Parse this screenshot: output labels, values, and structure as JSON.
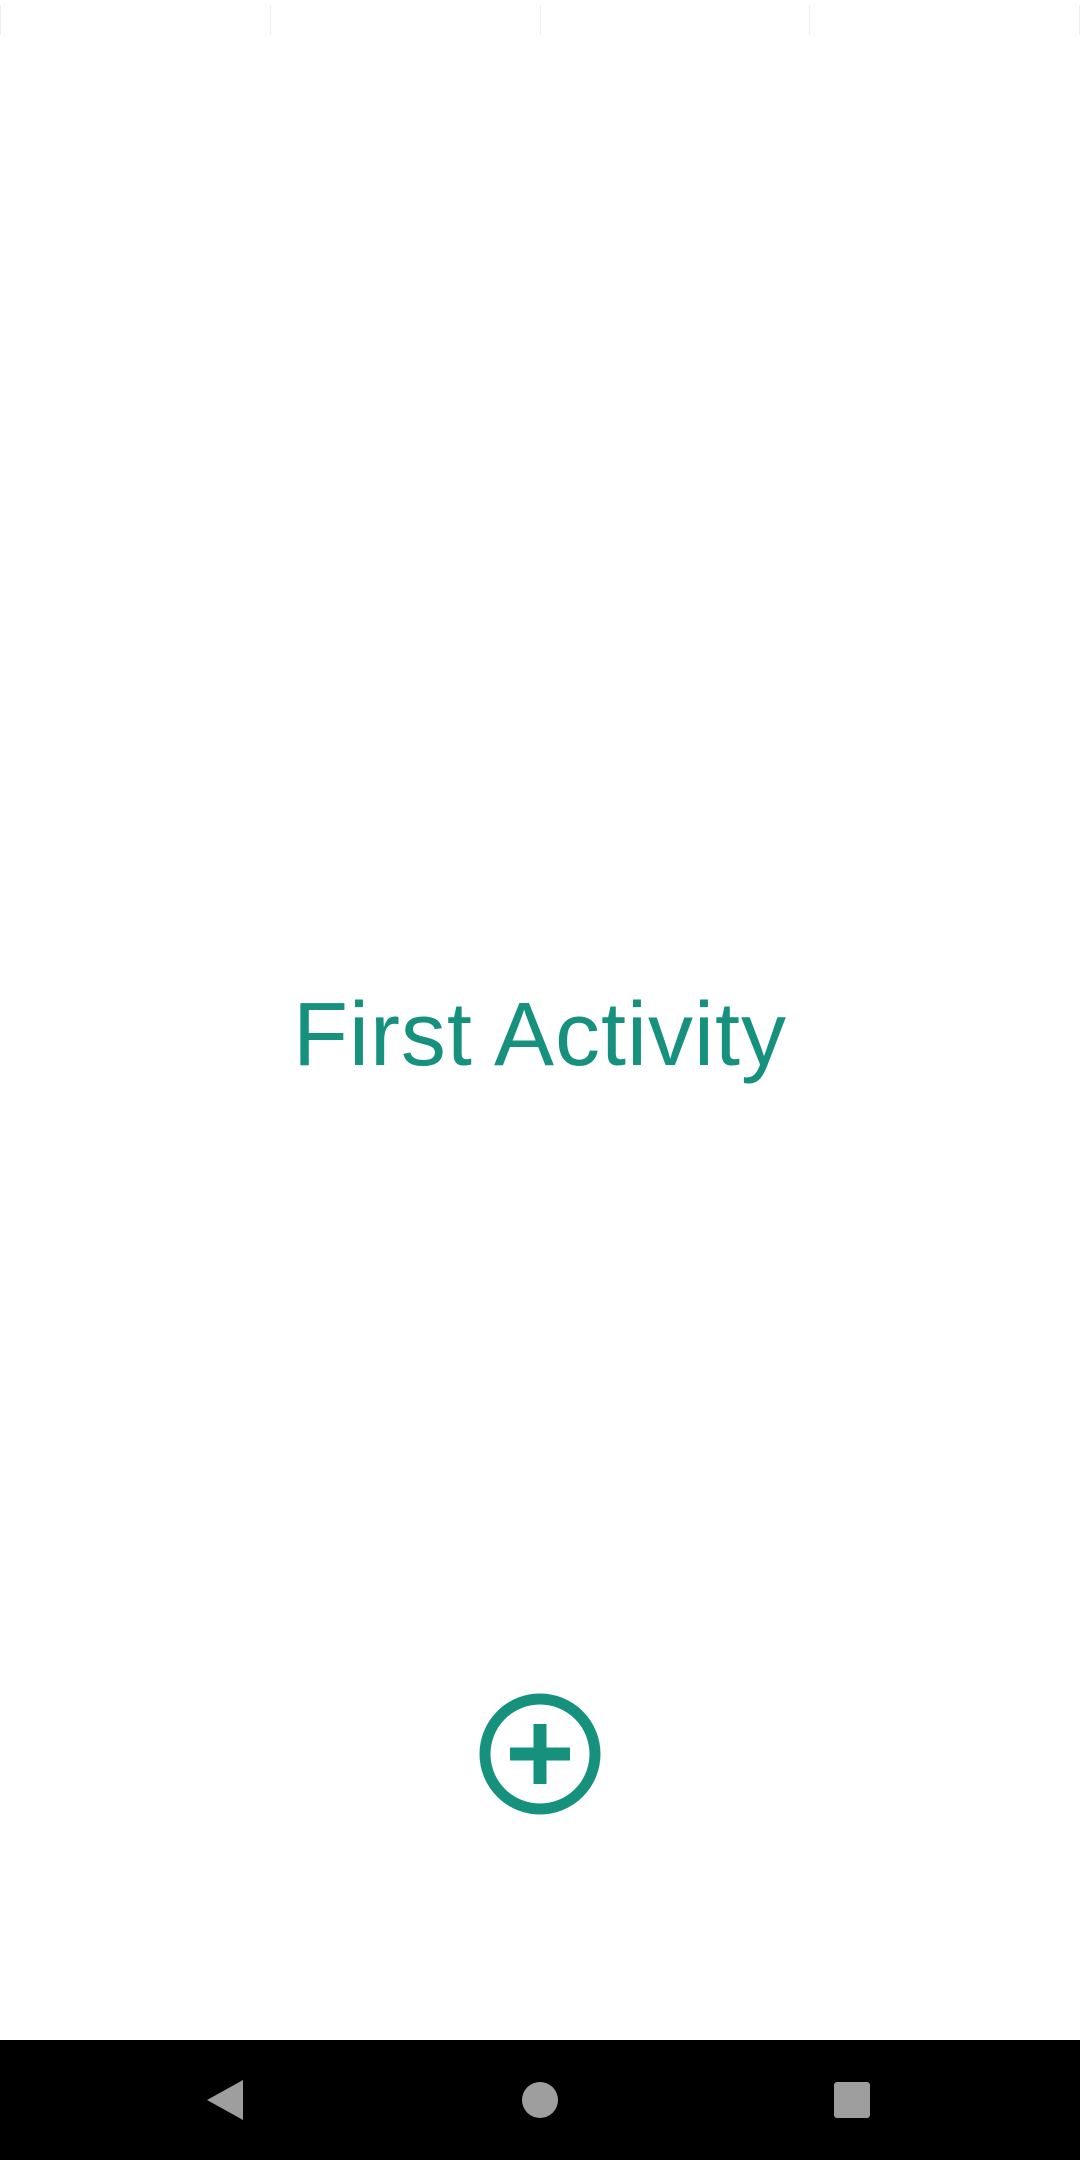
{
  "screen": {
    "title": "First Activity"
  },
  "actions": {
    "add_icon": "add-circle-outline-icon"
  },
  "navigation": {
    "back_icon": "back-triangle-icon",
    "home_icon": "home-circle-icon",
    "recents_icon": "recents-square-icon"
  },
  "colors": {
    "accent": "#16917e",
    "background": "#ffffff",
    "nav_bar": "#000000",
    "nav_icons": "#9e9e9e"
  }
}
